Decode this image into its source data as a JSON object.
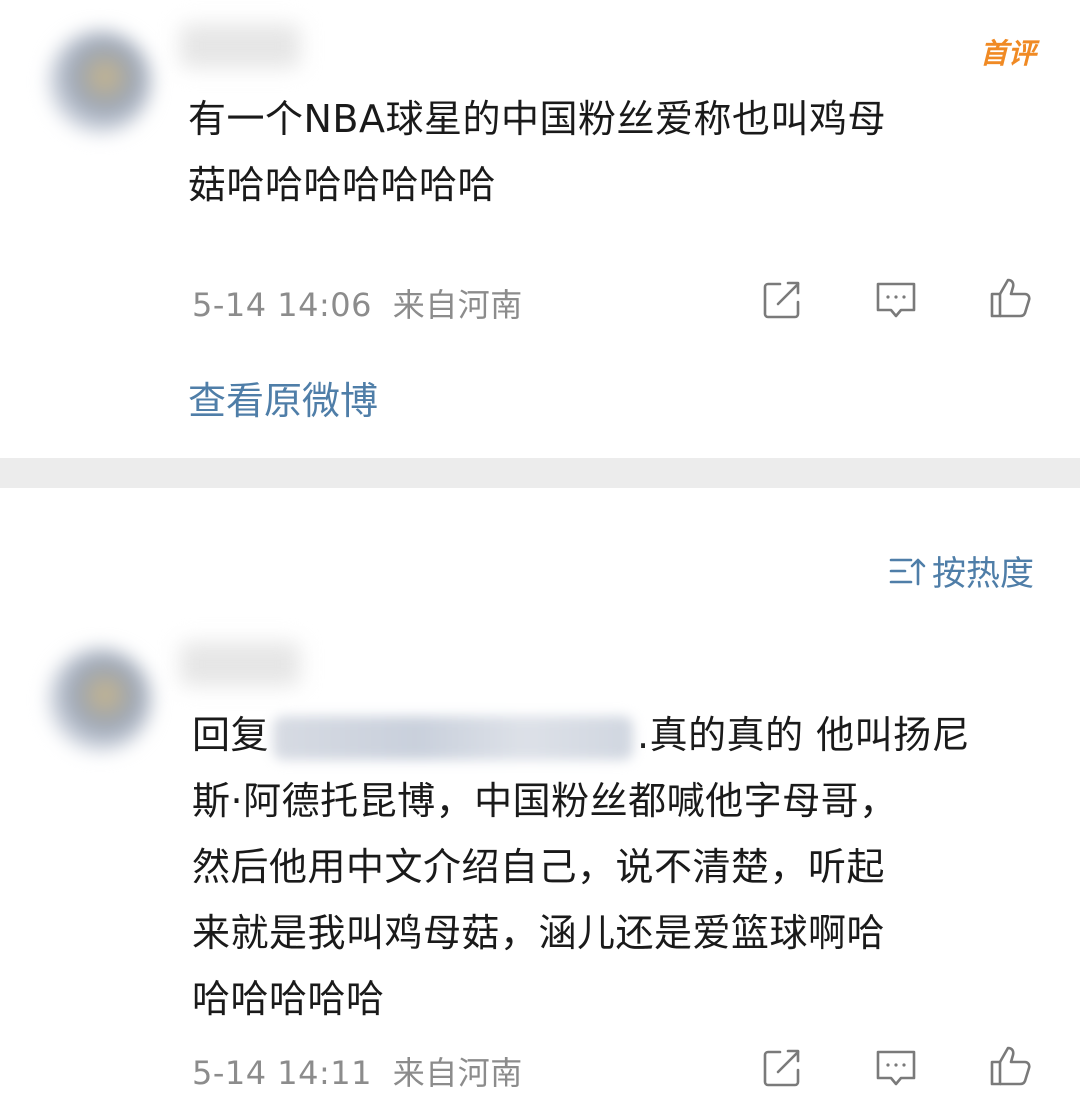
{
  "top_comment": {
    "badge": "首评",
    "text_line1": "有一个NBA球星的中国粉丝爱称也叫鸡母",
    "text_line2": "菇哈哈哈哈哈哈哈",
    "date": "5-14 14:06",
    "location": "来自河南",
    "view_original": "查看原微博",
    "icons": [
      "share-icon",
      "comment-icon",
      "like-icon"
    ]
  },
  "sort": {
    "label": "按热度",
    "icon": "sort-icon"
  },
  "reply_comment": {
    "reply_prefix": "回复",
    "text_line1_tail": ".真的真的   他叫扬尼",
    "text_line2": "斯·阿德托昆博，中国粉丝都喊他字母哥，",
    "text_line3": "然后他用中文介绍自己，说不清楚，听起",
    "text_line4": "来就是我叫鸡母菇，涵儿还是爱篮球啊哈",
    "text_line5": "哈哈哈哈哈",
    "date": "5-14 14:11",
    "location": "来自河南",
    "icons": [
      "share-icon",
      "comment-icon",
      "like-icon"
    ]
  },
  "colors": {
    "link": "#4f7ea8",
    "badge": "#f08a24",
    "meta": "#8c8c8c",
    "divider": "#ececec"
  }
}
